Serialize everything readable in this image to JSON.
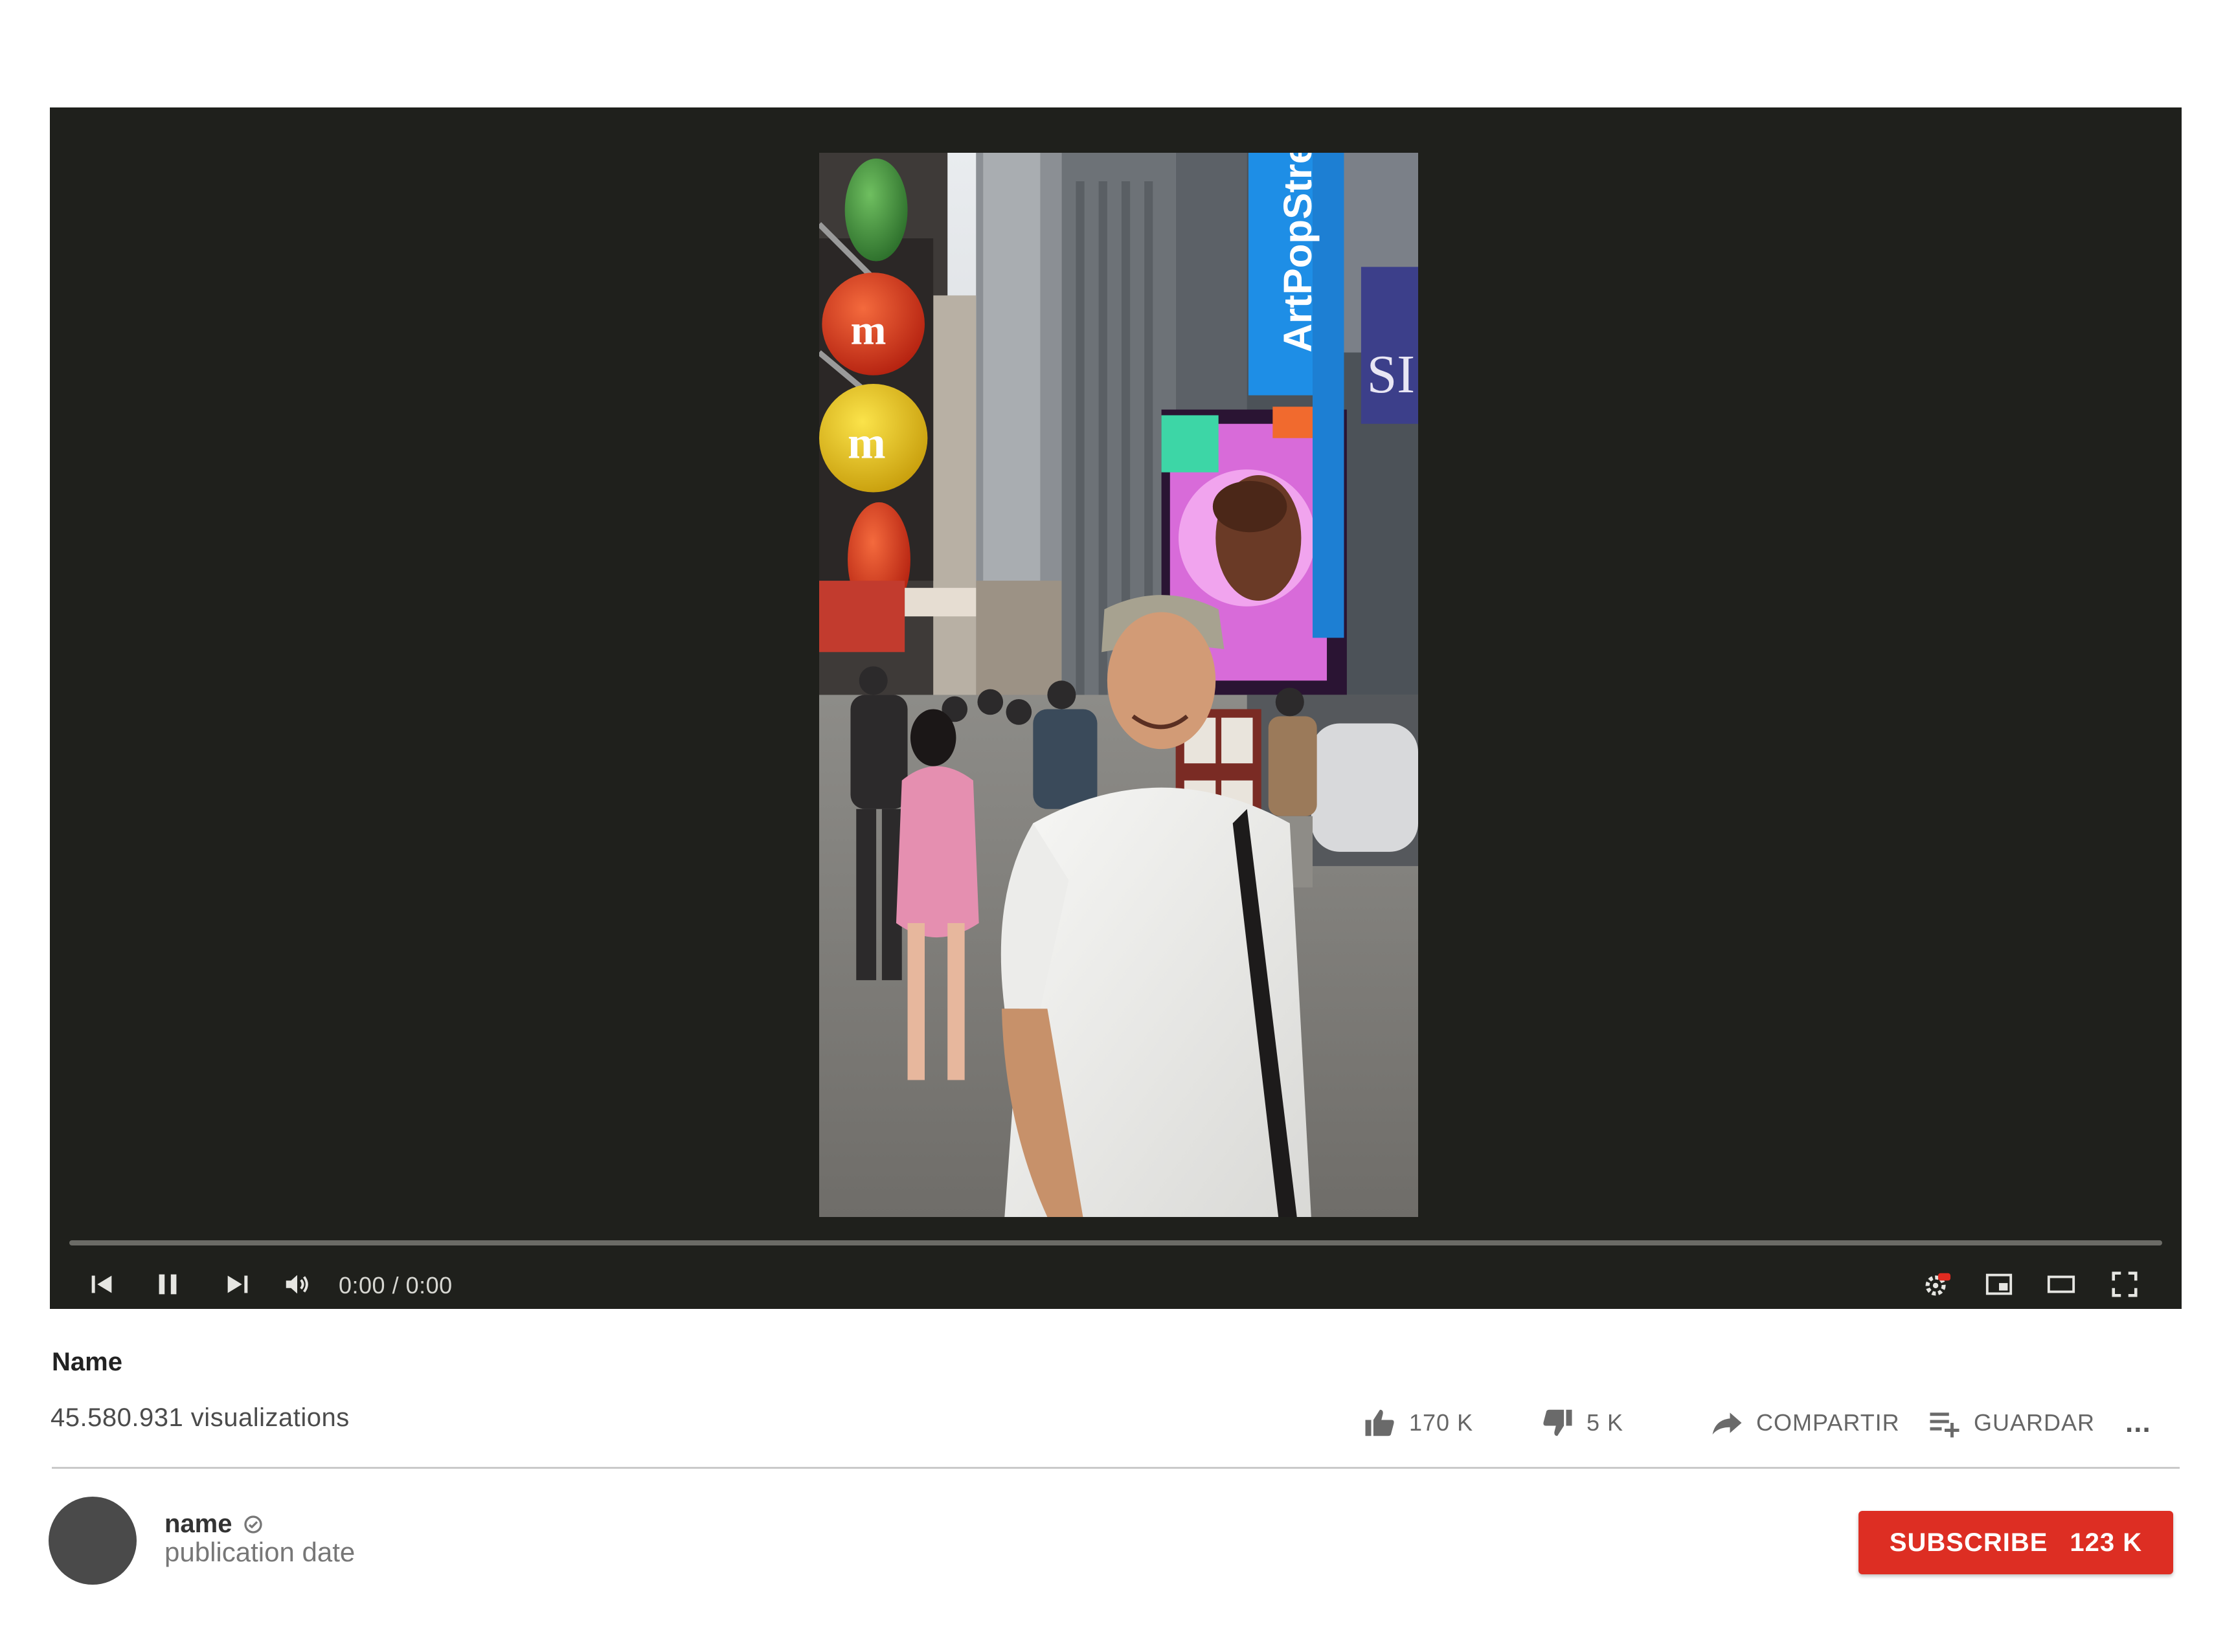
{
  "player": {
    "time_display": "0:00 / 0:00",
    "progress": 0,
    "video_scene": {
      "billboard_text": "ArtPopStreet"
    }
  },
  "video": {
    "title": "Name",
    "views": "45.580.931 visualizations"
  },
  "actions": {
    "like_count": "170 K",
    "dislike_count": "5 K",
    "share_label": "COMPARTIR",
    "save_label": "GUARDAR",
    "more_label": "..."
  },
  "channel": {
    "name": "name",
    "publication_date": "publication date",
    "subscribe_label": "SUBSCRIBE",
    "subscriber_count": "123 K"
  },
  "icons": [
    "previous-icon",
    "pause-icon",
    "next-icon",
    "volume-icon",
    "settings-icon",
    "miniplayer-icon",
    "theater-mode-icon",
    "fullscreen-icon",
    "thumbs-up-icon",
    "thumbs-down-icon",
    "share-icon",
    "save-playlist-icon",
    "verified-icon"
  ],
  "colors": {
    "player_bg": "#1f201c",
    "subscribe_bg": "#dd2e23",
    "billboard_blue": "#1f8fe6"
  }
}
